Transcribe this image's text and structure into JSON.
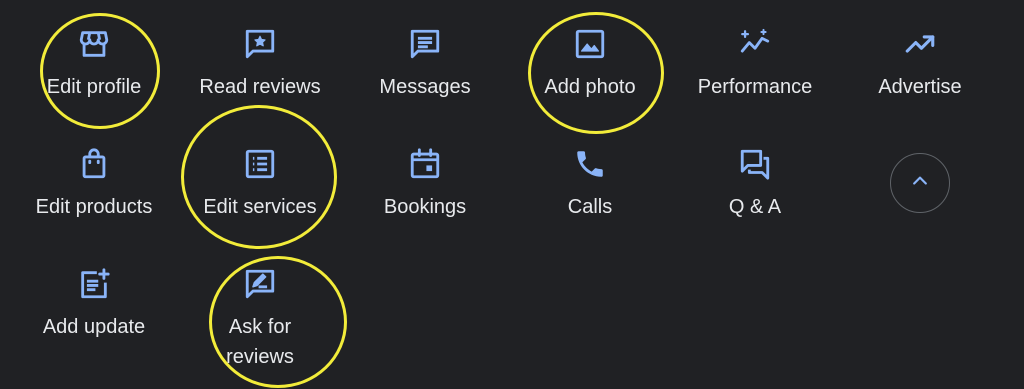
{
  "colors": {
    "background": "#202124",
    "icon": "#8ab4f8",
    "label": "#e8eaed",
    "highlight_ring": "#f2ec3a"
  },
  "actions": [
    {
      "label": "Edit profile",
      "icon": "storefront-icon"
    },
    {
      "label": "Read reviews",
      "icon": "star-review-icon"
    },
    {
      "label": "Messages",
      "icon": "message-icon"
    },
    {
      "label": "Add photo",
      "icon": "image-icon"
    },
    {
      "label": "Performance",
      "icon": "sparkle-trend-icon"
    },
    {
      "label": "Advertise",
      "icon": "trending-up-icon"
    },
    {
      "label": "Edit products",
      "icon": "shopping-bag-icon"
    },
    {
      "label": "Edit services",
      "icon": "list-icon"
    },
    {
      "label": "Bookings",
      "icon": "calendar-icon"
    },
    {
      "label": "Calls",
      "icon": "phone-icon"
    },
    {
      "label": "Q & A",
      "icon": "forum-icon"
    },
    {
      "label": "Add update",
      "icon": "post-add-icon"
    },
    {
      "label": "Ask for reviews",
      "icon": "rate-review-icon"
    }
  ],
  "collapse_button": {
    "icon": "chevron-up-icon"
  }
}
